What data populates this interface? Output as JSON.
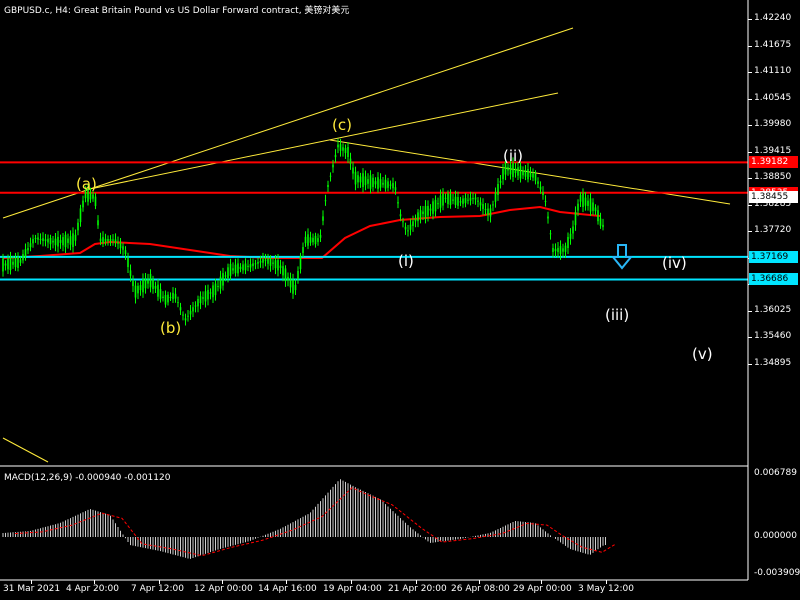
{
  "window": {
    "title": "GBPUSD.c, H4:  Great Britain Pound vs US Dollar Forward contract, 美镑对美元"
  },
  "price_axis": {
    "ticks": [
      "1.42240",
      "1.41675",
      "1.41110",
      "1.40545",
      "1.39980",
      "1.39415",
      "1.38850",
      "1.38285",
      "1.37720",
      "1.37155",
      "1.36590",
      "1.36025",
      "1.35460",
      "1.34895"
    ],
    "badges": [
      {
        "label": "1.39182",
        "color": "#ff0000",
        "text_color": "#ffffff"
      },
      {
        "label": "1.38535",
        "color": "#ff0000",
        "text_color": "#ffffff"
      },
      {
        "label": "1.38455",
        "color": "#ffffff",
        "text_color": "#000000"
      },
      {
        "label": "1.37169",
        "color": "#00e5ff",
        "text_color": "#000000"
      },
      {
        "label": "1.36686",
        "color": "#00e5ff",
        "text_color": "#000000"
      }
    ]
  },
  "macd": {
    "label": "MACD(12,26,9) -0.000940 -0.001120",
    "ticks": [
      "0.006789",
      "0.000000",
      "-0.003909"
    ]
  },
  "time_axis": {
    "ticks": [
      "31 Mar 2021",
      "4 Apr 20:00",
      "7 Apr 12:00",
      "12 Apr 00:00",
      "14 Apr 16:00",
      "19 Apr 04:00",
      "21 Apr 20:00",
      "26 Apr 08:00",
      "29 Apr 00:00",
      "3 May 12:00"
    ]
  },
  "wave_labels": {
    "a": "(a)",
    "b": "(b)",
    "c": "(c)",
    "i": "(i)",
    "ii": "(ii)",
    "iii": "(iii)",
    "iv": "(iv)",
    "v": "(v)"
  },
  "colors": {
    "bull_candle": "#00ff00",
    "moving_average": "#ff0000",
    "trendline": "#ffeb3b",
    "resistance": "#ff0000",
    "support": "#00e5ff",
    "grid": "#3a3a3a",
    "arrow": "#29b6f6"
  },
  "icons": {
    "down_arrow": "down-arrow-icon"
  }
}
